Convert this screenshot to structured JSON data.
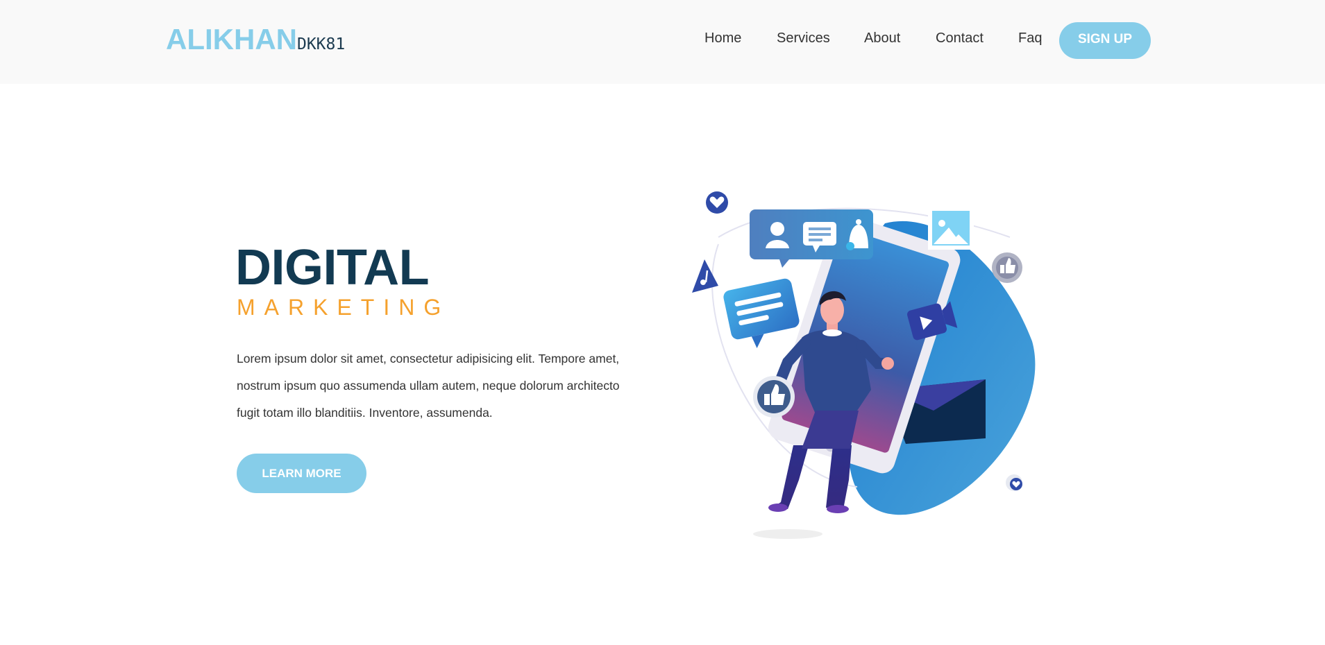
{
  "header": {
    "logo_main": "ALIKHAN",
    "logo_sub": "DKK81",
    "nav": [
      "Home",
      "Services",
      "About",
      "Contact",
      "Faq"
    ],
    "signup_label": "SIGN UP"
  },
  "hero": {
    "title": "DIGITAL",
    "subtitle": "MARKETING",
    "text": "Lorem ipsum dolor sit amet, consectetur adipisicing elit. Tempore amet, nostrum ipsum quo assumenda ullam autem, neque dolorum architecto fugit totam illo blanditiis. Inventore, assumenda.",
    "cta_label": "LEARN MORE"
  },
  "colors": {
    "accent": "#86cde9",
    "title": "#123a52",
    "subtitle": "#f5a12d",
    "header_bg": "#f9f9f9"
  }
}
